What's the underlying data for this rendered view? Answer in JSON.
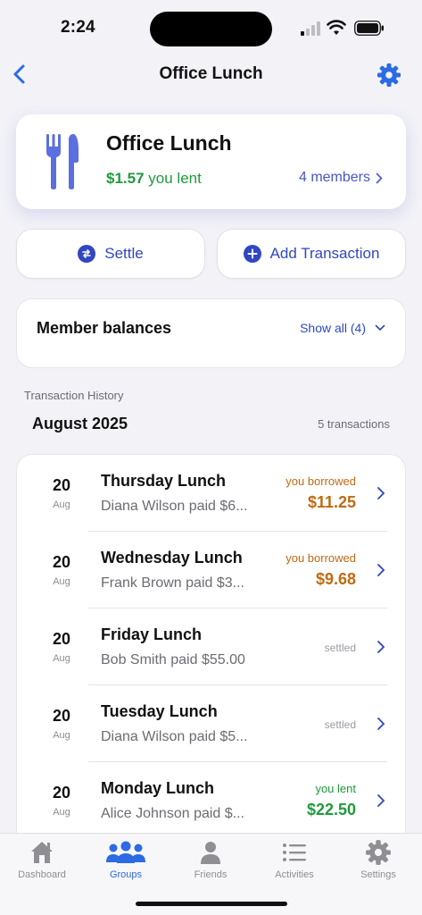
{
  "status_bar": {
    "time": "2:24"
  },
  "nav": {
    "title": "Office Lunch"
  },
  "group": {
    "name": "Office Lunch",
    "lent_amount": "$1.57",
    "lent_label": "you lent",
    "members_label": "4 members"
  },
  "actions": {
    "settle_label": "Settle",
    "add_transaction_label": "Add Transaction"
  },
  "balances": {
    "title": "Member balances",
    "show_all_label": "Show all (4)"
  },
  "history": {
    "section_label": "Transaction History",
    "month": "August 2025",
    "count_label": "5 transactions",
    "transactions": [
      {
        "day": "20",
        "month": "Aug",
        "title": "Thursday Lunch",
        "subtitle": "Diana Wilson paid $6...",
        "status": "you borrowed",
        "amount": "$11.25",
        "kind": "borrowed"
      },
      {
        "day": "20",
        "month": "Aug",
        "title": "Wednesday Lunch",
        "subtitle": "Frank Brown paid $3...",
        "status": "you borrowed",
        "amount": "$9.68",
        "kind": "borrowed"
      },
      {
        "day": "20",
        "month": "Aug",
        "title": "Friday Lunch",
        "subtitle": "Bob Smith paid $55.00",
        "status": "settled",
        "amount": "",
        "kind": "settled"
      },
      {
        "day": "20",
        "month": "Aug",
        "title": "Tuesday Lunch",
        "subtitle": "Diana Wilson paid $5...",
        "status": "settled",
        "amount": "",
        "kind": "settled"
      },
      {
        "day": "20",
        "month": "Aug",
        "title": "Monday Lunch",
        "subtitle": "Alice Johnson paid $...",
        "status": "you lent",
        "amount": "$22.50",
        "kind": "lent"
      }
    ]
  },
  "tabs": [
    {
      "label": "Dashboard",
      "icon": "house-icon",
      "active": false
    },
    {
      "label": "Groups",
      "icon": "people-icon",
      "active": true
    },
    {
      "label": "Friends",
      "icon": "person-icon",
      "active": false
    },
    {
      "label": "Activities",
      "icon": "list-icon",
      "active": false
    },
    {
      "label": "Settings",
      "icon": "gear-icon",
      "active": false
    }
  ],
  "colors": {
    "accent": "#2c6be3",
    "borrowed": "#c06a12",
    "lent": "#1f9a3c",
    "settled": "#9a9aa2",
    "icon_blue": "#5b6fe0"
  }
}
